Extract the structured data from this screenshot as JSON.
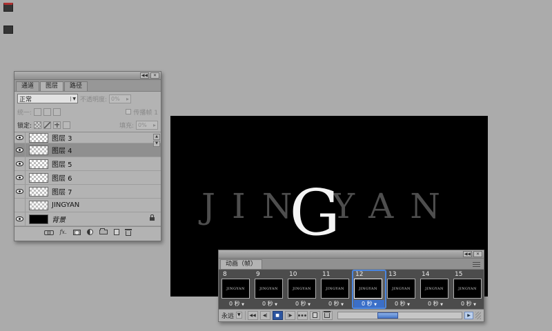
{
  "layers_panel": {
    "titlebar": {
      "collapse_glyph": "◀◀",
      "close_glyph": "✕"
    },
    "tabs": [
      {
        "label": "通道"
      },
      {
        "label": "图层"
      },
      {
        "label": "路径"
      }
    ],
    "blend_value": "正常",
    "blend_arrow": "▼",
    "opacity_label": "不透明度:",
    "opacity_value": "0%",
    "opacity_arrow": "▸",
    "unify_label": "统一:",
    "propagate_label": "传播帧 1",
    "lock_label": "锁定:",
    "fill_label": "填充:",
    "fill_value": "0%",
    "fill_arrow": "▸",
    "scroll_up_glyph": "▲",
    "scroll_down_glyph": "▼",
    "fx_label": "fx.",
    "layers": [
      {
        "name": "图层 3"
      },
      {
        "name": "图层 4"
      },
      {
        "name": "图层 5"
      },
      {
        "name": "图层 6"
      },
      {
        "name": "图层 7"
      },
      {
        "name": "JINGYAN"
      },
      {
        "name": "背景"
      }
    ]
  },
  "canvas": {
    "left_letters": "JIN",
    "g_letter": "G",
    "right_letters": "YAN"
  },
  "animation_panel": {
    "titlebar": {
      "collapse_glyph": "◀◀",
      "close_glyph": "✕"
    },
    "tab_label": "动画（帧）",
    "mini_word": "JINGYAN",
    "delay_arrow": "▼",
    "loop_value": "永远",
    "loop_arrow": "▼",
    "controls": {
      "first_frame": "◀◀",
      "prev_frame": "◀|",
      "stop": "■",
      "next_frame": "|▶",
      "scroll_right": "▶"
    },
    "frames": [
      {
        "num": "8",
        "delay": "0 秒"
      },
      {
        "num": "9",
        "delay": "0 秒"
      },
      {
        "num": "10",
        "delay": "0 秒"
      },
      {
        "num": "11",
        "delay": "0 秒"
      },
      {
        "num": "12",
        "delay": "0 秒"
      },
      {
        "num": "13",
        "delay": "0 秒"
      },
      {
        "num": "14",
        "delay": "0 秒"
      },
      {
        "num": "15",
        "delay": "0 秒"
      }
    ]
  }
}
